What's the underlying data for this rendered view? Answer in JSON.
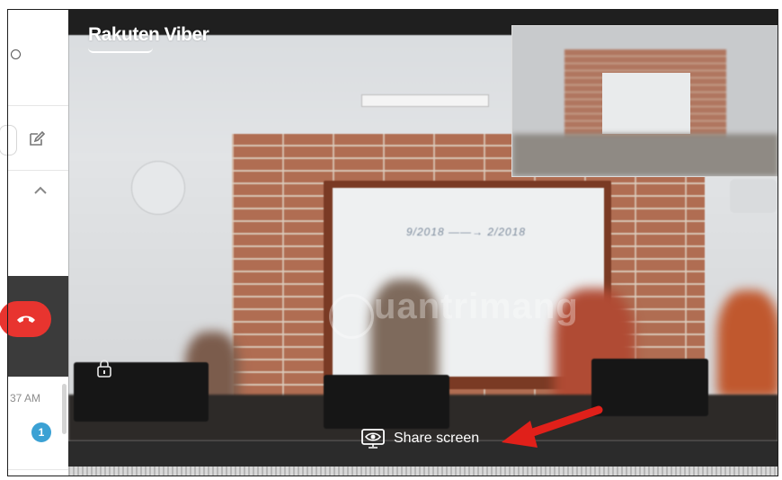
{
  "brand": {
    "logo_text": "Rakuten Viber"
  },
  "sidebar": {
    "call_time": "37 AM",
    "unread_count": "1"
  },
  "call": {
    "share_screen_label": "Share screen",
    "whiteboard_scribble": "9/2018 ——→ 2/2018",
    "watermark": "uantrimang"
  },
  "colors": {
    "end_call_red": "#e8342f",
    "badge_blue": "#3ba1d4",
    "annotation_arrow": "#e0201a"
  },
  "icons": {
    "sidebar_edit": "compose-icon",
    "sidebar_collapse": "chevron-up-icon",
    "end_call": "phone-hangup-icon",
    "lock": "lock-icon",
    "share": "eye-screen-icon"
  }
}
